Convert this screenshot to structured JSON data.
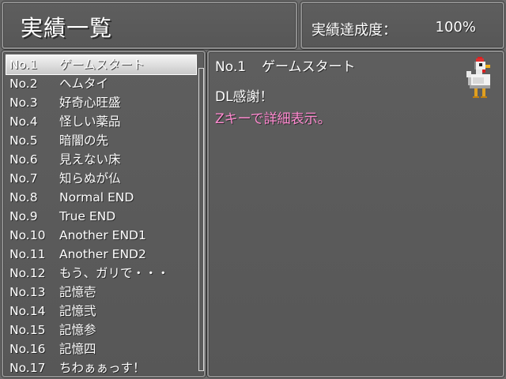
{
  "header": {
    "title": "実績一覧",
    "completion_label": "実績達成度：",
    "completion_value": "100%"
  },
  "list": {
    "selected_index": 0,
    "items": [
      {
        "num": "No.1",
        "name": "ゲームスタート"
      },
      {
        "num": "No.2",
        "name": "ヘムタイ"
      },
      {
        "num": "No.3",
        "name": "好奇心旺盛"
      },
      {
        "num": "No.4",
        "name": "怪しい薬品"
      },
      {
        "num": "No.5",
        "name": "暗闇の先"
      },
      {
        "num": "No.6",
        "name": "見えない床"
      },
      {
        "num": "No.7",
        "name": "知らぬが仏"
      },
      {
        "num": "No.8",
        "name": "Normal END"
      },
      {
        "num": "No.9",
        "name": "True END"
      },
      {
        "num": "No.10",
        "name": "Another END1"
      },
      {
        "num": "No.11",
        "name": "Another END2"
      },
      {
        "num": "No.12",
        "name": "もう、ガリで・・・"
      },
      {
        "num": "No.13",
        "name": "記憶壱"
      },
      {
        "num": "No.14",
        "name": "記憶弐"
      },
      {
        "num": "No.15",
        "name": "記憶参"
      },
      {
        "num": "No.16",
        "name": "記憶四"
      },
      {
        "num": "No.17",
        "name": "ちわぁぁっす！"
      }
    ]
  },
  "detail": {
    "num": "No.1",
    "name": "ゲームスタート",
    "line1": "DL感謝！",
    "line2": "Zキーで詳細表示。",
    "line2_color": "#ff8ad0",
    "icon": "chicken-sprite"
  }
}
